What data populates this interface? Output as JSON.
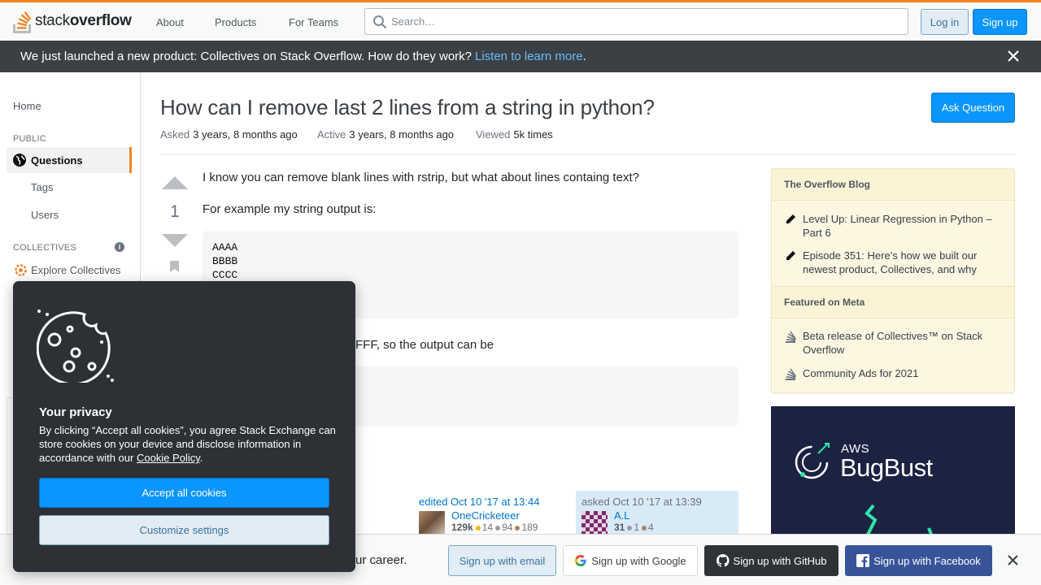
{
  "header": {
    "logo_light": "stack",
    "logo_bold": "overflow",
    "nav": [
      "About",
      "Products",
      "For Teams"
    ],
    "search_placeholder": "Search…",
    "login_label": "Log in",
    "signup_label": "Sign up"
  },
  "announcement": {
    "text": "We just launched a new product: Collectives on Stack Overflow. How do they work?",
    "link": "Listen to learn more",
    "suffix": "."
  },
  "leftnav": {
    "home": "Home",
    "public_heading": "PUBLIC",
    "questions": "Questions",
    "tags": "Tags",
    "users": "Users",
    "collectives_heading": "COLLECTIVES",
    "info_glyph": "i",
    "explore": "Explore Collectives"
  },
  "question": {
    "title": "How can I remove last 2 lines from a string in python?",
    "ask_button": "Ask Question",
    "asked_label": "Asked",
    "asked_value": "3 years, 8 months ago",
    "active_label": "Active",
    "active_value": "3 years, 8 months ago",
    "viewed_label": "Viewed",
    "viewed_value": "5k times",
    "votes": "1",
    "para1": "I know you can remove blank lines with rstrip, but what about lines containg text?",
    "para2": "For example my string output is:",
    "code1": [
      "AAAA",
      "BBBB",
      "CCCC"
    ],
    "para3_fragment": "FFF, so the output can be",
    "edited_label": "edited Oct 10 '17 at 13:44",
    "editor_name": "OneCricketeer",
    "editor_rep": "129k",
    "editor_gold": "14",
    "editor_silver": "94",
    "editor_bronze": "189",
    "asked_by_label": "asked Oct 10 '17 at 13:39",
    "author_name": "A.L",
    "author_rep": "31",
    "author_silver": "1",
    "author_bronze": "4"
  },
  "sidebar": {
    "blog_heading": "The Overflow Blog",
    "blog_items": [
      "Level Up: Linear Regression in Python – Part 6",
      "Episode 351: Here’s how we built our newest product, Collectives, and why"
    ],
    "meta_heading": "Featured on Meta",
    "meta_items": [
      "Beta release of Collectives™ on Stack Overflow",
      "Community Ads for 2021"
    ],
    "ad_small": "AWS",
    "ad_big": "BugBust"
  },
  "signup_bar": {
    "text_fragment": "ur career.",
    "email": "Sign up with email",
    "google": "Sign up with Google",
    "github": "Sign up with GitHub",
    "facebook": "Sign up with Facebook"
  },
  "cookie": {
    "title": "Your privacy",
    "text_before_link": "By clicking “Accept all cookies”, you agree Stack Exchange can store cookies on your device and disclose information in accordance with our",
    "link": "Cookie Policy",
    "text_after_link": ".",
    "accept": "Accept all cookies",
    "customize": "Customize settings"
  },
  "colors": {
    "accent_orange": "#f48225",
    "primary_blue": "#0a95ff",
    "announce_bg": "#3b4045",
    "widget_bg": "#fdf7e2"
  }
}
